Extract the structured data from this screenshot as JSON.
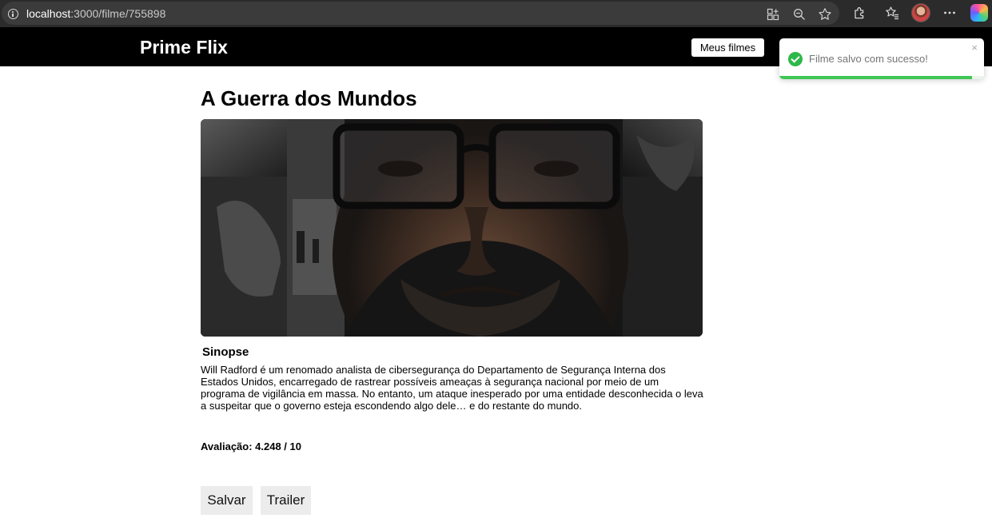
{
  "browser": {
    "url_host": "localhost",
    "url_path": ":3000/filme/755898"
  },
  "header": {
    "brand": "Prime Flix",
    "my_movies_label": "Meus filmes"
  },
  "toast": {
    "message": "Filme salvo com sucesso!",
    "close_symbol": "×",
    "progress": 0.94,
    "accent_color": "#3fc755"
  },
  "movie": {
    "title": "A Guerra dos Mundos",
    "poster_alt": "A Guerra dos Mundos",
    "synopsis_heading": "Sinopse",
    "synopsis": "Will Radford é um renomado analista de cibersegurança do Departamento de Segurança Interna dos Estados Unidos, encarregado de rastrear possíveis ameaças à segurança nacional por meio de um programa de vigilância em massa. No entanto, um ataque inesperado por uma entidade desconhecida o leva a suspeitar que o governo esteja escondendo algo dele… e do restante do mundo.",
    "rating_label": "Avaliação: 4.248 / 10"
  },
  "actions": {
    "save_label": "Salvar",
    "trailer_label": "Trailer"
  }
}
